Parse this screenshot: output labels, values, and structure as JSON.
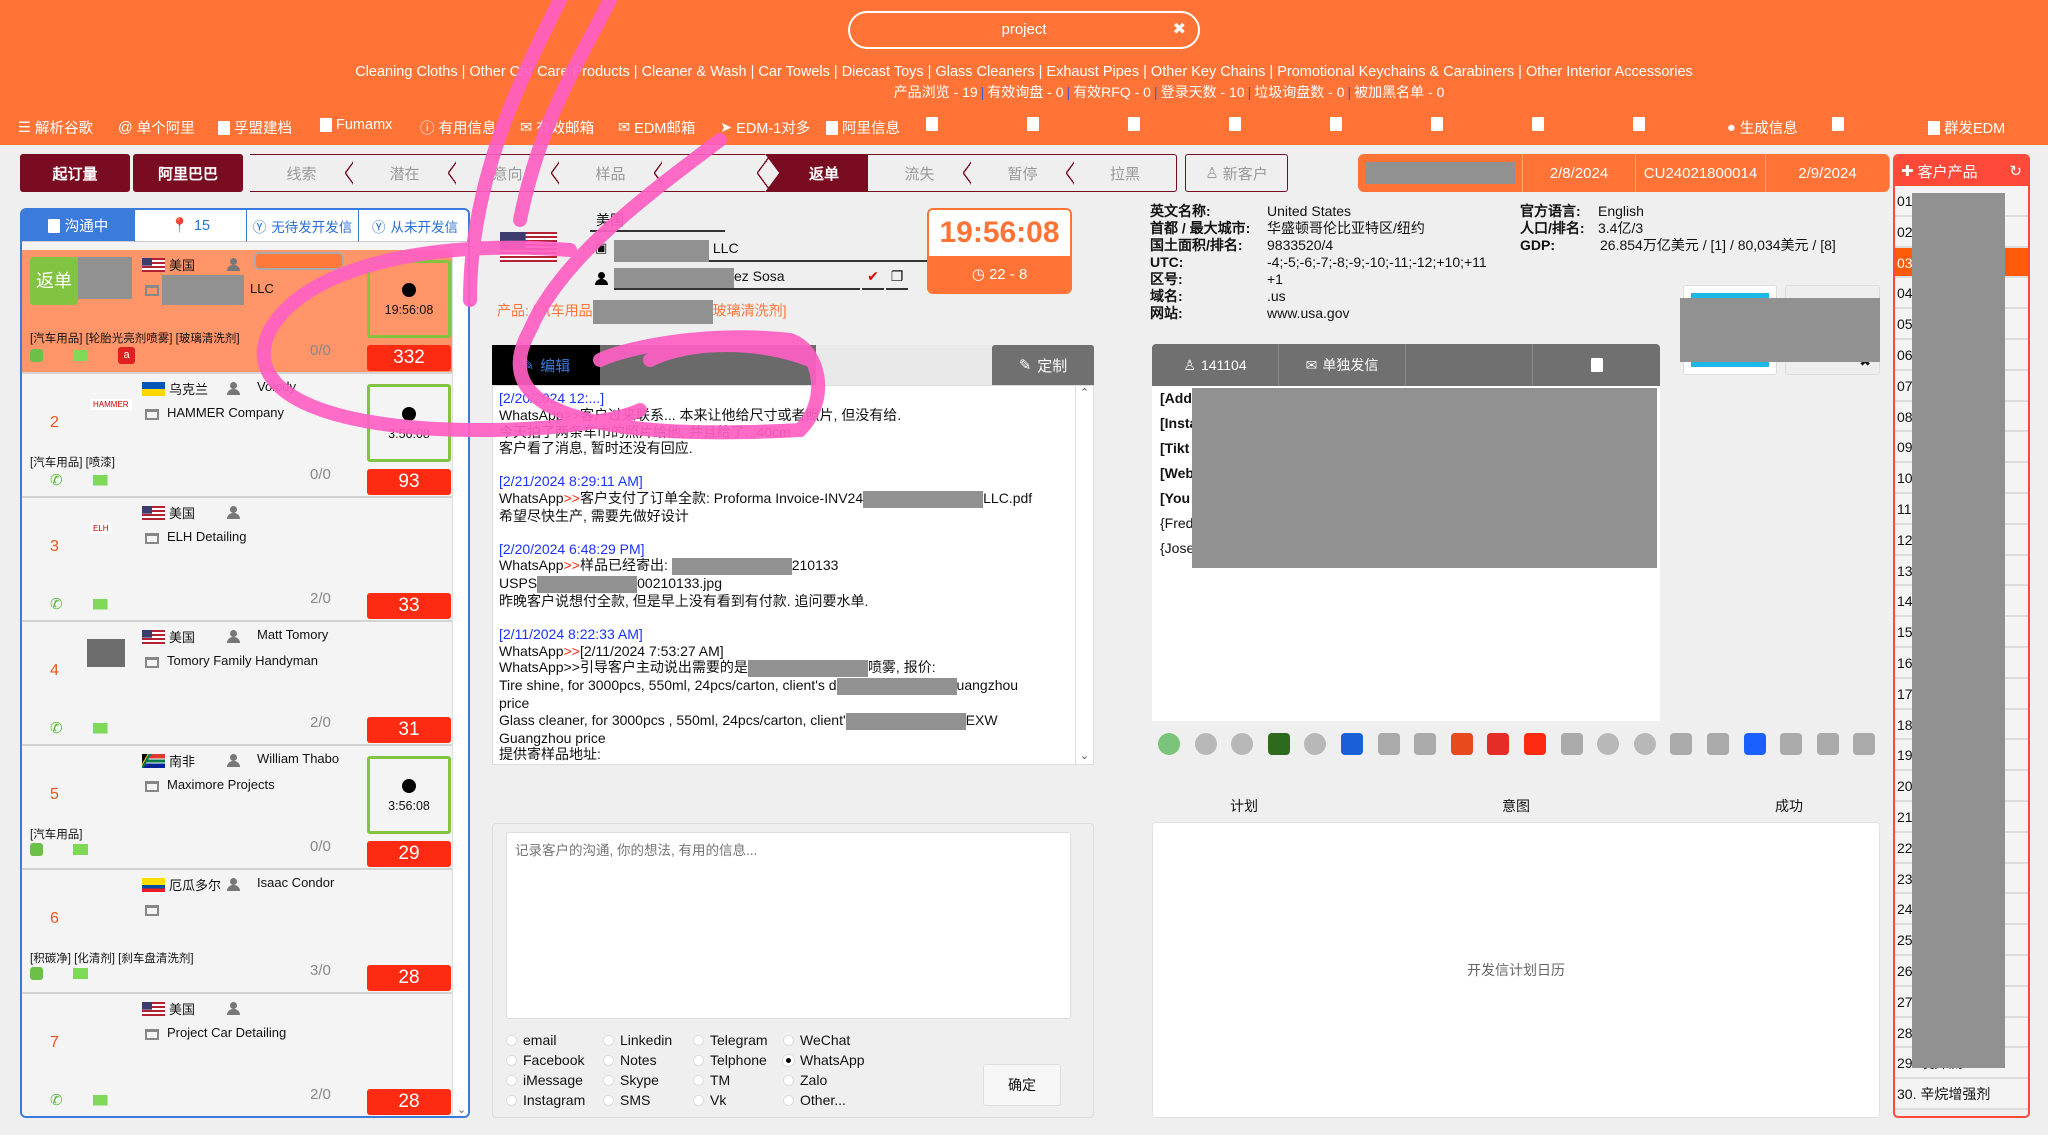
{
  "search": {
    "value": "project",
    "clear_icon": "close-icon"
  },
  "header": {
    "categories": "Cleaning Cloths | Other Car Care Products | Cleaner & Wash | Car Towels | Diecast Toys | Glass Cleaners | Exhaust Pipes | Other Key Chains | Promotional Keychains & Carabiners | Other Interior Accessories",
    "stats": [
      "产品浏览 - 19",
      "有效询盘 - 0",
      "有效RFQ - 0",
      "登录天数 - 10",
      "垃圾询盘数 - 0",
      "被加黑名单 - 0"
    ]
  },
  "toolbar": {
    "items": [
      "解析谷歌",
      "单个阿里",
      "孚盟建档",
      "Fumamx",
      "有用信息",
      "有效邮箱",
      "EDM邮箱",
      "EDM-1对多",
      "阿里信息"
    ],
    "generate": "生成信息",
    "bulk_edm": "群发EDM"
  },
  "pipeline": {
    "stages": [
      "起订量",
      "阿里巴巴",
      "线索",
      "潜在",
      "意向",
      "样品",
      "",
      "返单",
      "流失",
      "暂停",
      "拉黑"
    ],
    "active": "返单",
    "new_customer": "新客户"
  },
  "customer_header": {
    "date1": "2/8/2024",
    "code": "CU24021800014",
    "date2": "2/9/2024"
  },
  "left": {
    "tabs": [
      "沟通中",
      "15",
      "无待发开发信",
      "从未开发信"
    ],
    "rows": [
      {
        "badge": "返单",
        "flag": "us",
        "country": "美国",
        "name": "",
        "company": "LLC",
        "tags": "[汽车用品] [轮胎光亮剂喷雾] [玻璃清洗剂]",
        "icons": [
          "whatsapp",
          "email",
          "alibaba"
        ],
        "ratio": "0/0",
        "timer": "19:56:08",
        "days": "332",
        "selected": true
      },
      {
        "num": "2",
        "logo": "HAMMER",
        "flag": "ua",
        "country": "乌克兰",
        "name": "Volody",
        "company": "HAMMER Company",
        "tags": "[汽车用品] [喷漆]",
        "icons": [
          "phone",
          "email"
        ],
        "ratio": "0/0",
        "timer": "3:56:08",
        "days": "93"
      },
      {
        "num": "3",
        "logo": "ELH",
        "flag": "us",
        "country": "美国",
        "name": "",
        "company": "ELH Detailing",
        "tags": "",
        "icons": [
          "phone",
          "email"
        ],
        "ratio": "2/0",
        "days": "33"
      },
      {
        "num": "4",
        "flag": "us",
        "country": "美国",
        "name": "Matt Tomory",
        "company": "Tomory Family Handyman",
        "tags": "",
        "icons": [
          "phone",
          "email"
        ],
        "ratio": "2/0",
        "days": "31"
      },
      {
        "num": "5",
        "flag": "za",
        "country": "南非",
        "name": "William Thabo",
        "company": "Maximore Projects",
        "tags": "[汽车用品]",
        "icons": [
          "whatsapp",
          "email"
        ],
        "ratio": "0/0",
        "timer": "3:56:08",
        "days": "29"
      },
      {
        "num": "6",
        "flag": "ec",
        "country": "厄瓜多尔",
        "name": "Isaac Condor",
        "company": "",
        "tags": "[积碳净] [化清剂] [刹车盘清洗剂]",
        "icons": [
          "whatsapp",
          "email"
        ],
        "ratio": "3/0",
        "days": "28"
      },
      {
        "num": "7",
        "flag": "us",
        "country": "美国",
        "name": "",
        "company": "Project Car Detailing",
        "tags": "",
        "icons": [
          "phone",
          "email"
        ],
        "ratio": "2/0",
        "days": "28"
      }
    ]
  },
  "detail": {
    "country": "美国",
    "company": "LLC",
    "contact": "ez Sosa",
    "product_label": "产品: [汽车用品",
    "product_tail": "玻璃清洗剂]",
    "timer": "19:56:08",
    "tz": "22 - 8",
    "tabs": [
      "编辑",
      "",
      ""
    ],
    "custom": "定制",
    "log": [
      {
        "ts": "[2/20/2024 12:...]",
        "lines": [
          [
            "WhatsApp",
            ">>",
            "客户过来联系... 本来让他给尺寸或者照片, 但没有给."
          ],
          [
            "",
            "",
            "今天拍了两条车巾的照片给他, 并且给了...40cm"
          ],
          [
            "",
            "",
            "客户看了消息, 暂时还没有回应."
          ]
        ]
      },
      {
        "ts": "[2/21/2024 8:29:11 AM]",
        "lines": [
          [
            "WhatsApp",
            ">>",
            "客户支付了订单全款: Proforma Invoice-INV24",
            "LLC.pdf"
          ],
          [
            "",
            "",
            "希望尽快生产, 需要先做好设计"
          ]
        ]
      },
      {
        "ts": "[2/20/2024 6:48:29 PM]",
        "lines": [
          [
            "WhatsApp",
            ">>",
            "样品已经寄出: ",
            "210133"
          ],
          [
            "",
            "",
            "USPS",
            "00210133.jpg"
          ],
          [
            "",
            "",
            "昨晚客户说想付全款, 但是早上没有看到有付款. 追问要水单."
          ]
        ]
      },
      {
        "ts": "[2/11/2024 8:22:33 AM]",
        "lines": [
          [
            "WhatsApp",
            ">>",
            "[2/11/2024 7:53:27 AM]"
          ],
          [
            "",
            "",
            "WhatsApp>>引导客户主动说出需要的是",
            "喷雾, 报价:"
          ],
          [
            "",
            "",
            "Tire shine, for 3000pcs, 550ml, 24pcs/carton, client's d",
            "uangzhou"
          ],
          [
            "",
            "",
            "price"
          ],
          [
            "",
            "",
            "Glass cleaner, for 3000pcs , 550ml, 24pcs/carton, client'",
            "EXW"
          ],
          [
            "",
            "",
            "Guangzhou price"
          ],
          [
            "",
            "",
            "提供寄样品地址:"
          ]
        ]
      }
    ],
    "notes_placeholder": "记录客户的沟通, 你的想法, 有用的信息...",
    "channels": [
      [
        "email",
        "Linkedin",
        "Telegram",
        "WeChat"
      ],
      [
        "Facebook",
        "Notes",
        "Telphone",
        "WhatsApp"
      ],
      [
        "iMessage",
        "Skype",
        "TM",
        "Zalo"
      ],
      [
        "Instagram",
        "SMS",
        "Vk",
        "Other..."
      ]
    ],
    "selected_channel": "WhatsApp",
    "confirm": "确定"
  },
  "country_info": {
    "left": [
      [
        "英文名称:",
        "United States"
      ],
      [
        "首都 / 最大城市:",
        "华盛顿哥伦比亚特区/纽约"
      ],
      [
        "国土面积/排名:",
        "9833520/4"
      ],
      [
        "UTC:",
        "-4;-5;-6;-7;-8;-9;-10;-11;-12;+10;+11"
      ],
      [
        "区号:",
        "+1"
      ],
      [
        "域名:",
        ".us"
      ],
      [
        "网站:",
        "www.usa.gov"
      ]
    ],
    "right": [
      [
        "官方语言:",
        "English"
      ],
      [
        "人口/排名:",
        "3.4亿/3"
      ],
      [
        "GDP:",
        "26.854万亿美元 / [1] / 80,034美元 / [8]"
      ]
    ]
  },
  "contact_panel": {
    "tabs": [
      "141104",
      "单独发信",
      "",
      ""
    ],
    "lines": [
      "[Add",
      "[Insta",
      "[Tikt",
      "[Web",
      "[You",
      "{Fred",
      "{Jose"
    ]
  },
  "social_icons": [
    [
      "email-icon",
      "#5cb85c"
    ],
    [
      "mobile-icon",
      "#aaa"
    ],
    [
      "phone-icon",
      "#aaa"
    ],
    [
      "whatsapp-icon",
      "#2d6a1e"
    ],
    [
      "wechat-icon",
      "#aaa"
    ],
    [
      "globe-icon",
      "#1a5fd6"
    ],
    [
      "asterisk-icon",
      "#aaa"
    ],
    [
      "facebook-icon",
      "#aaa"
    ],
    [
      "instagram-icon",
      "#e8491d"
    ],
    [
      "youtube-icon",
      "#e52d27"
    ],
    [
      "tiktok-icon",
      "#ff2a12"
    ],
    [
      "linkedin-icon",
      "#aaa"
    ],
    [
      "twitter-icon",
      "#aaa"
    ],
    [
      "yelp-icon",
      "#aaa"
    ],
    [
      "viber-icon",
      "#aaa"
    ],
    [
      "zalo-icon",
      "#aaa"
    ],
    [
      "location-icon",
      "#1a5fff"
    ],
    [
      "snapchat-icon",
      "#aaa"
    ],
    [
      "square-icon",
      "#aaa"
    ],
    [
      "square-icon",
      "#aaa"
    ]
  ],
  "plan": {
    "labels": [
      "计划",
      "意图",
      "成功"
    ],
    "calendar": "开发信计划日历"
  },
  "products": {
    "title": "客户产品",
    "items": [
      "01",
      "02",
      "03",
      "04",
      "05",
      "06",
      "07",
      "08",
      "09",
      "10",
      "11",
      "12",
      "13",
      "14",
      "15",
      "16",
      "17",
      "18",
      "19",
      "20",
      "21",
      "22",
      "23",
      "24",
      "25",
      "26",
      "27",
      "28",
      "29. 发外流",
      "30. 辛烷增强剂"
    ],
    "highlighted": "03"
  },
  "colors": {
    "brand": "#ff7436",
    "maroon": "#7a0c22",
    "blue": "#3b7bdc",
    "green": "#82c341",
    "red": "#ff2a12"
  }
}
